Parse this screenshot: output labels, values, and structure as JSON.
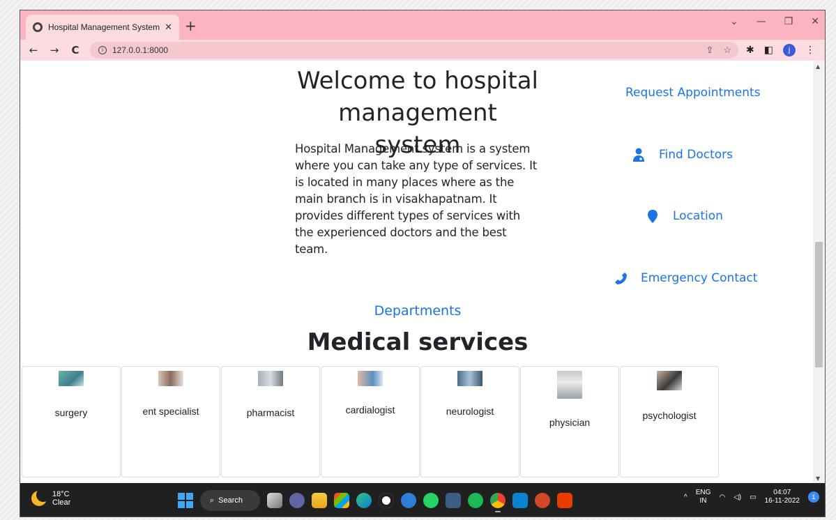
{
  "browser": {
    "tab_title": "Hospital Management System",
    "tab_close": "✕",
    "new_tab": "+",
    "url": "127.0.0.1:8000",
    "window_controls": {
      "chevron": "⌄",
      "minimize": "—",
      "restore": "❐",
      "close": "✕"
    },
    "nav": {
      "back": "←",
      "forward": "→",
      "reload": "C"
    },
    "profile_initial": "j"
  },
  "page": {
    "heading": "Welcome to hospital management system",
    "intro": "Hospital Management system is a system where you can take any type of services. It is located in many places where as the main branch is in visakhapatnam. It provides different types of services with the experienced doctors and the best team.",
    "side_links": {
      "appointments": "Request Appointments",
      "doctors": "Find Doctors",
      "location": "Location",
      "emergency": "Emergency Contact"
    },
    "departments_link": "Departments",
    "services_title": "Medical services",
    "services": [
      {
        "label": "surgery"
      },
      {
        "label": "ent specialist"
      },
      {
        "label": "pharmacist"
      },
      {
        "label": "cardialogist"
      },
      {
        "label": "neurologist"
      },
      {
        "label": "physician"
      },
      {
        "label": "psychologist"
      }
    ]
  },
  "taskbar": {
    "weather_temp": "18°C",
    "weather_desc": "Clear",
    "search_label": "Search",
    "lang_top": "ENG",
    "lang_bottom": "IN",
    "time": "04:07",
    "date": "16-11-2022",
    "notification_count": "1"
  },
  "colors": {
    "tab_strip": "#fcb5c0",
    "toolbar": "#fcdce1",
    "link": "#1a73e8",
    "taskbar": "#202020"
  }
}
